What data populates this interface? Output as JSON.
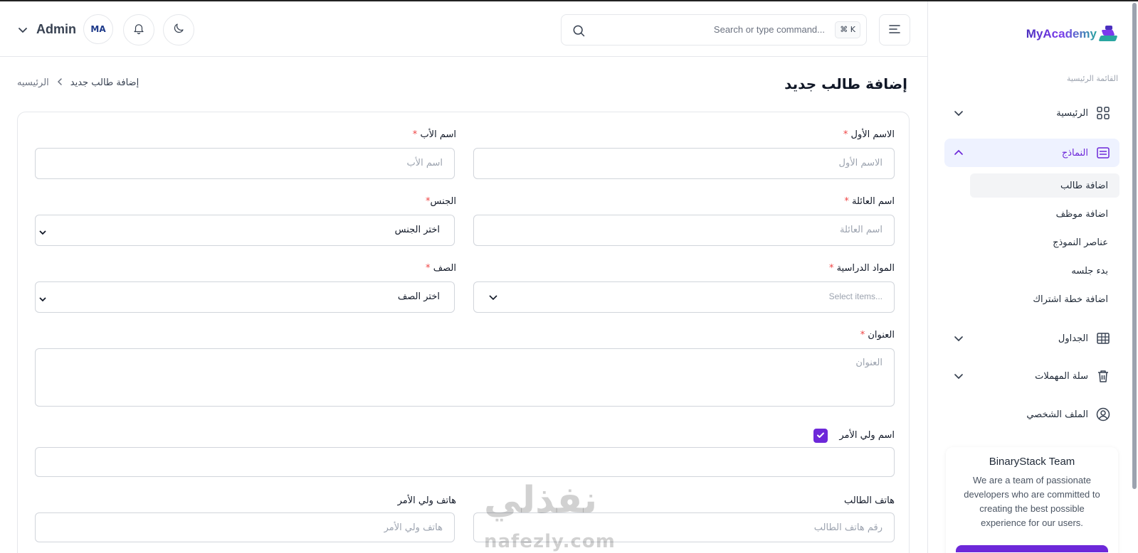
{
  "header": {
    "search_placeholder": "Search or type command...",
    "search_shortcut": "⌘ K",
    "user_name": "Admin",
    "avatar_initials": "MA"
  },
  "sidebar": {
    "logo": "MyAcademy",
    "caption": "القائمة الرئيسية",
    "items": [
      {
        "label": "الرئيسية",
        "icon": "grid-icon"
      },
      {
        "label": "النماذج",
        "icon": "form-icon"
      },
      {
        "label": "الجداول",
        "icon": "table-icon"
      },
      {
        "label": "سلة المهملات",
        "icon": "trash-icon"
      },
      {
        "label": "الملف الشخصي",
        "icon": "user-icon"
      }
    ],
    "subitems": [
      "اضافة طالب",
      "اضافة موظف",
      "عناصر النموذج",
      "بدء جلسه",
      "اضافة خطة اشتراك"
    ],
    "team": {
      "title": "BinaryStack Team",
      "desc": "We are a team of passionate developers who are committed to creating the best possible experience for our users."
    }
  },
  "main": {
    "title": "إضافة طالب جديد",
    "breadcrumb_home": "الرئيسيه",
    "breadcrumb_current": "إضافة طالب جديد"
  },
  "form": {
    "first_name": {
      "label": "الاسم الأول",
      "placeholder": "الاسم الأول"
    },
    "father_name": {
      "label": "اسم الأب",
      "placeholder": "اسم الأب"
    },
    "family_name": {
      "label": "اسم العائلة",
      "placeholder": "اسم العائلة"
    },
    "gender": {
      "label": "الجنس",
      "value": "اختر الجنس"
    },
    "subjects": {
      "label": "المواد الدراسية",
      "placeholder": "Select items..."
    },
    "grade": {
      "label": "الصف",
      "value": "اختر الصف"
    },
    "address": {
      "label": "العنوان",
      "placeholder": "العنوان"
    },
    "guardian_name": {
      "label": "اسم ولي الأمر",
      "checked": true
    },
    "student_phone": {
      "label": "هاتف الطالب",
      "placeholder": "رقم هاتف الطالب"
    },
    "guardian_phone": {
      "label": "هاتف ولي الأمر",
      "placeholder": "هاتف ولي الأمر"
    }
  },
  "watermark": {
    "ar": "نفذلي",
    "en": "nafezly.com"
  },
  "colors": {
    "accent": "#6d28d9",
    "required": "#ef4444"
  }
}
